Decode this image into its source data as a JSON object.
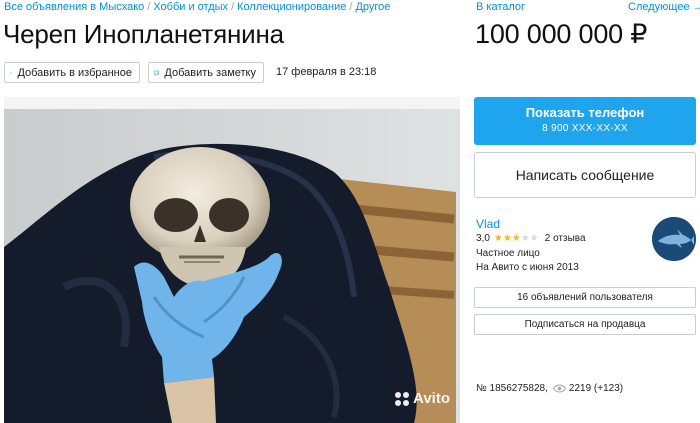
{
  "breadcrumbs": [
    "Все объявления в Мысхако",
    "Хобби и отдых",
    "Коллекционирование",
    "Другое"
  ],
  "breadcrumb_separator": "/",
  "catalog_link": "В каталог",
  "next_link": "Следующее →",
  "title": "Череп Инопланетянина",
  "price": "100 000 000 ₽",
  "actions": {
    "favorite_label": "Добавить в избранное",
    "note_label": "Добавить заметку"
  },
  "posted_date": "17 февраля в 23:18",
  "photo": {
    "watermark": "Avito"
  },
  "contact": {
    "show_phone_label": "Показать телефон",
    "phone_masked": "8 900 XXX-XX-XX",
    "message_label": "Написать сообщение"
  },
  "seller": {
    "name": "Vlad",
    "rating": "3,0",
    "rating_value": 3,
    "rating_max": 5,
    "reviews": "2 отзыва",
    "type": "Частное лицо",
    "since": "На Авито с июня 2013",
    "ads_button": "16 объявлений пользователя",
    "subscribe_button": "Подписаться на продавца"
  },
  "listing": {
    "id_text": "№ 1856275828,",
    "views": "2219 (+123)"
  },
  "colors": {
    "link": "#0091d9",
    "primary_button": "#1fa4ee",
    "star_on": "#ffb021",
    "star_off": "#d8d8d8",
    "border": "#c9ced3"
  }
}
